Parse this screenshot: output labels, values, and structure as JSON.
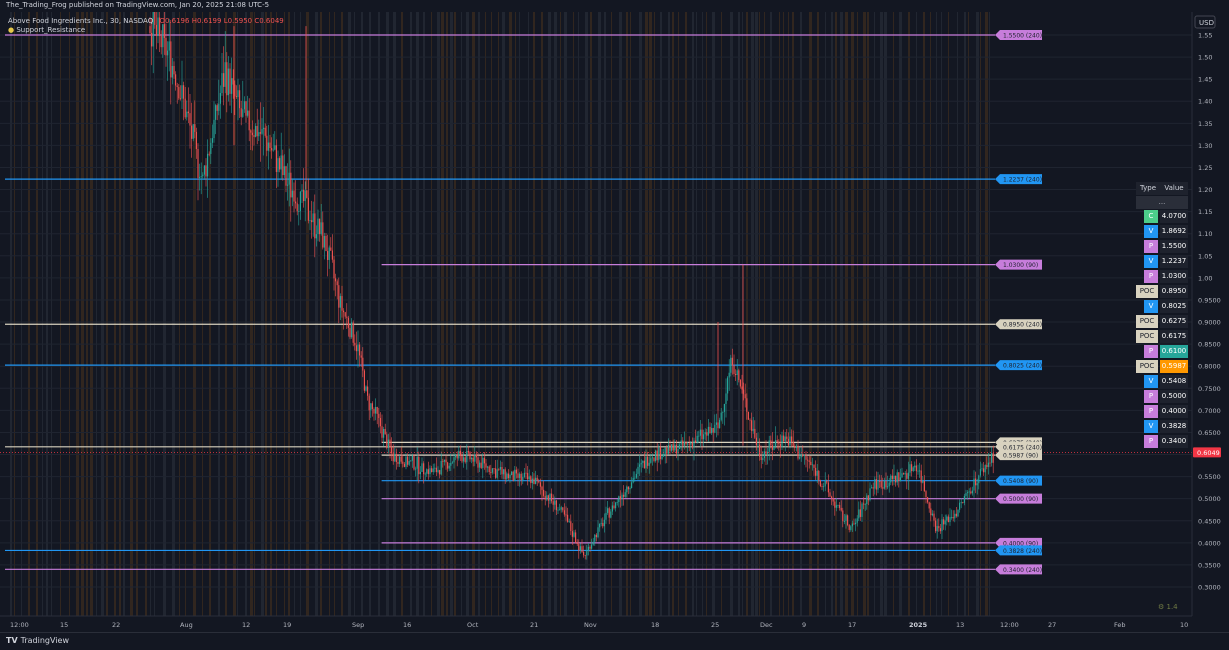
{
  "header": {
    "published": "The_Trading_Frog published on TradingView.com, Jan 20, 2025 21:08 UTC-5"
  },
  "legend": {
    "symbol": "Above Food Ingredients Inc., 30, NASDAQ",
    "ohlc_open": "O0.6196",
    "ohlc_high": "H0.6199",
    "ohlc_low": "L0.5950",
    "ohlc_close": "C0.6049",
    "indicator": "Support_Resistance"
  },
  "price_axis": {
    "currency": "USD",
    "last_price": "0.6049",
    "ticks": [
      "1.55",
      "1.50",
      "1.45",
      "1.40",
      "1.35",
      "1.30",
      "1.25",
      "1.20",
      "1.15",
      "1.10",
      "1.05",
      "1.00",
      "0.9500",
      "0.9000",
      "0.8500",
      "0.8000",
      "0.7500",
      "0.7000",
      "0.6500",
      "0.6000",
      "0.5500",
      "0.5000",
      "0.4500",
      "0.4000",
      "0.3500",
      "0.3000"
    ]
  },
  "time_axis": {
    "ticks": [
      "12:00",
      "15",
      "22",
      "Aug",
      "12",
      "19",
      "Sep",
      "16",
      "Oct",
      "21",
      "Nov",
      "18",
      "25",
      "Dec",
      "9",
      "17",
      "2025",
      "13",
      "12:00",
      "27",
      "Feb",
      "10"
    ]
  },
  "footer": {
    "brand": "TradingView",
    "watermark": "⚙ 1.4"
  },
  "colors": {
    "background": "#131722",
    "support_p": "#c77ddb",
    "support_v": "#2196f3",
    "support_poc": "#d8d2bf",
    "support_c": "#4ccd8a",
    "candle_up": "#26a69a",
    "candle_down": "#ef5350",
    "last_price": "#f23645",
    "highlight_green": "#26a69a",
    "highlight_orange": "#ff9800"
  },
  "chart_data": {
    "type": "candlestick",
    "title": "Above Food Ingredients Inc., 30, NASDAQ",
    "ylim": [
      0.28,
      1.57
    ],
    "y_scale": "linear",
    "price_path": [
      [
        "Jul 26",
        1.57
      ],
      [
        "Jul 30",
        1.5
      ],
      [
        "Aug 2",
        1.38
      ],
      [
        "Aug 5",
        1.22
      ],
      [
        "Aug 9",
        1.47
      ],
      [
        "Aug 12",
        1.36
      ],
      [
        "Aug 16",
        1.32
      ],
      [
        "Aug 20",
        1.21
      ],
      [
        "Aug 23",
        1.17
      ],
      [
        "Aug 27",
        1.08
      ],
      [
        "Aug 30",
        0.94
      ],
      [
        "Sep 3",
        0.84
      ],
      [
        "Sep 6",
        0.72
      ],
      [
        "Sep 10",
        0.66
      ],
      [
        "Sep 13",
        0.6
      ],
      [
        "Sep 18",
        0.58
      ],
      [
        "Sep 23",
        0.56
      ],
      [
        "Sep 30",
        0.6
      ],
      [
        "Oct 8",
        0.57
      ],
      [
        "Oct 15",
        0.55
      ],
      [
        "Oct 22",
        0.54
      ],
      [
        "Oct 28",
        0.46
      ],
      [
        "Nov 1",
        0.37
      ],
      [
        "Nov 6",
        0.45
      ],
      [
        "Nov 12",
        0.53
      ],
      [
        "Nov 18",
        0.6
      ],
      [
        "Nov 22",
        0.62
      ],
      [
        "Nov 26",
        0.66
      ],
      [
        "Nov 28",
        0.82
      ],
      [
        "Dec 2",
        0.6
      ],
      [
        "Dec 6",
        0.64
      ],
      [
        "Dec 11",
        0.57
      ],
      [
        "Dec 16",
        0.46
      ],
      [
        "Dec 18",
        0.43
      ],
      [
        "Dec 23",
        0.53
      ],
      [
        "Dec 30",
        0.55
      ],
      [
        "Jan 3",
        0.58
      ],
      [
        "Jan 8",
        0.43
      ],
      [
        "Jan 13",
        0.47
      ],
      [
        "Jan 17",
        0.55
      ],
      [
        "Jan 20",
        0.6049
      ]
    ],
    "levels": [
      {
        "price": 1.55,
        "label": "1.5500 (240)",
        "type": "P",
        "start": "full"
      },
      {
        "price": 1.2237,
        "label": "1.2237 (240)",
        "type": "V",
        "start": "full"
      },
      {
        "price": 1.03,
        "label": "1.0300 (90)",
        "type": "P",
        "start": "Sep 10"
      },
      {
        "price": 0.895,
        "label": "0.8950 (240)",
        "type": "POC",
        "start": "full"
      },
      {
        "price": 0.8025,
        "label": "0.8025 (240)",
        "type": "V",
        "start": "full"
      },
      {
        "price": 0.6275,
        "label": "0.6275 (240)",
        "type": "POC",
        "start": "Sep 10"
      },
      {
        "price": 0.6175,
        "label": "0.6175 (240)",
        "type": "POC",
        "start": "full"
      },
      {
        "price": 0.5987,
        "label": "0.5987 (90)",
        "type": "POC",
        "start": "Sep 10"
      },
      {
        "price": 0.5408,
        "label": "0.5408 (90)",
        "type": "V",
        "start": "Sep 10"
      },
      {
        "price": 0.5,
        "label": "0.5000 (90)",
        "type": "P",
        "start": "Sep 10"
      },
      {
        "price": 0.4,
        "label": "0.4000 (90)",
        "type": "P",
        "start": "Sep 10"
      },
      {
        "price": 0.3828,
        "label": "0.3828 (240)",
        "type": "V",
        "start": "full"
      },
      {
        "price": 0.34,
        "label": "0.3400 (240)",
        "type": "P",
        "start": "full"
      }
    ]
  },
  "table": {
    "headers": [
      "Type",
      "Value"
    ],
    "placeholder": "...",
    "rows": [
      {
        "type": "C",
        "value": "4.0700",
        "kind": "C"
      },
      {
        "type": "V",
        "value": "1.8692",
        "kind": "V"
      },
      {
        "type": "P",
        "value": "1.5500",
        "kind": "P"
      },
      {
        "type": "V",
        "value": "1.2237",
        "kind": "V"
      },
      {
        "type": "P",
        "value": "1.0300",
        "kind": "P"
      },
      {
        "type": "POC",
        "value": "0.8950",
        "kind": "POC"
      },
      {
        "type": "V",
        "value": "0.8025",
        "kind": "V"
      },
      {
        "type": "POC",
        "value": "0.6275",
        "kind": "POC"
      },
      {
        "type": "POC",
        "value": "0.6175",
        "kind": "POC"
      },
      {
        "type": "P",
        "value": "0.6100",
        "kind": "P",
        "highlight": "green"
      },
      {
        "type": "POC",
        "value": "0.5987",
        "kind": "POC",
        "highlight": "orange"
      },
      {
        "type": "V",
        "value": "0.5408",
        "kind": "V"
      },
      {
        "type": "P",
        "value": "0.5000",
        "kind": "P"
      },
      {
        "type": "P",
        "value": "0.4000",
        "kind": "P"
      },
      {
        "type": "V",
        "value": "0.3828",
        "kind": "V"
      },
      {
        "type": "P",
        "value": "0.3400",
        "kind": "P"
      }
    ]
  }
}
